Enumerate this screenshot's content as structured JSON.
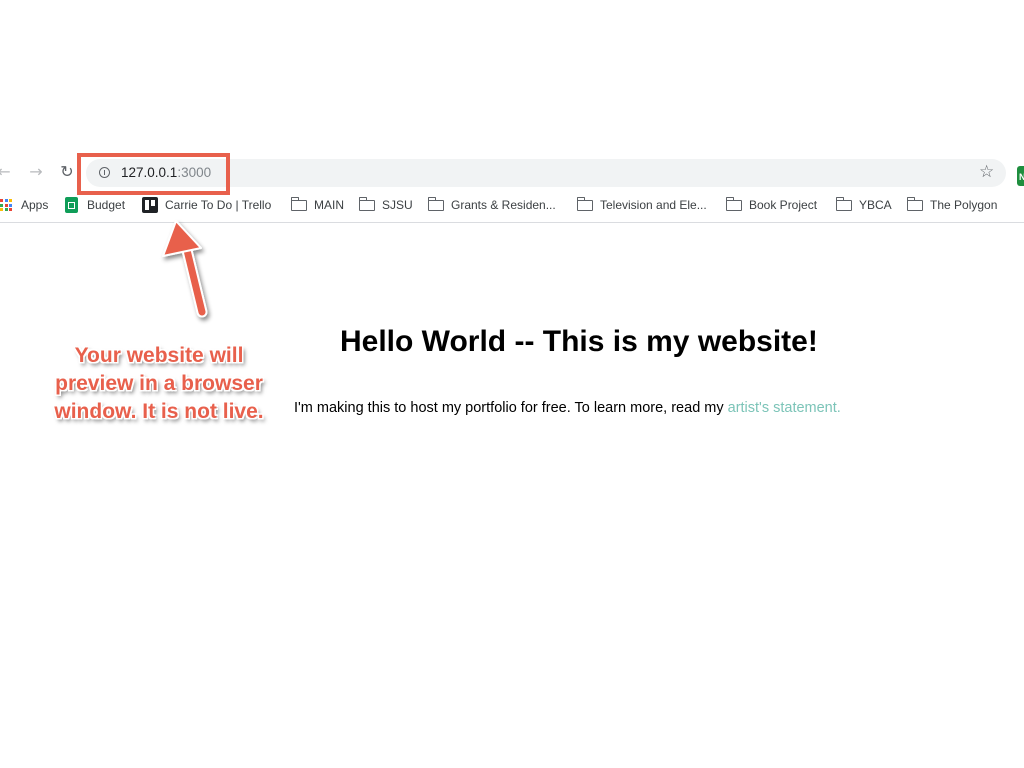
{
  "browser": {
    "url_host": "127.0.0.1",
    "url_port": ":3000",
    "bookmarks": [
      {
        "label": "Apps",
        "icon": "apps-grid-icon"
      },
      {
        "label": "Budget",
        "icon": "google-sheets-icon"
      },
      {
        "label": "Carrie To Do | Trello",
        "icon": "trello-icon"
      },
      {
        "label": "MAIN",
        "icon": "folder-icon"
      },
      {
        "label": "SJSU",
        "icon": "folder-icon"
      },
      {
        "label": "Grants & Residen...",
        "icon": "folder-icon"
      },
      {
        "label": "Television and Ele...",
        "icon": "folder-icon"
      },
      {
        "label": "Book Project",
        "icon": "folder-icon"
      },
      {
        "label": "YBCA",
        "icon": "folder-icon"
      },
      {
        "label": "The Polygon",
        "icon": "folder-icon"
      }
    ]
  },
  "annotation": {
    "lines": [
      "Your website will",
      "preview in a browser",
      "window. It is not live."
    ],
    "color": "#e8604c"
  },
  "page": {
    "heading": "Hello World -- This is my website!",
    "paragraph": "I'm making this to host my portfolio for free. To learn more, read my ",
    "link": "artist's statement."
  },
  "colors": {
    "link": "#7cc4b8",
    "omnibox": "#f1f3f4"
  }
}
